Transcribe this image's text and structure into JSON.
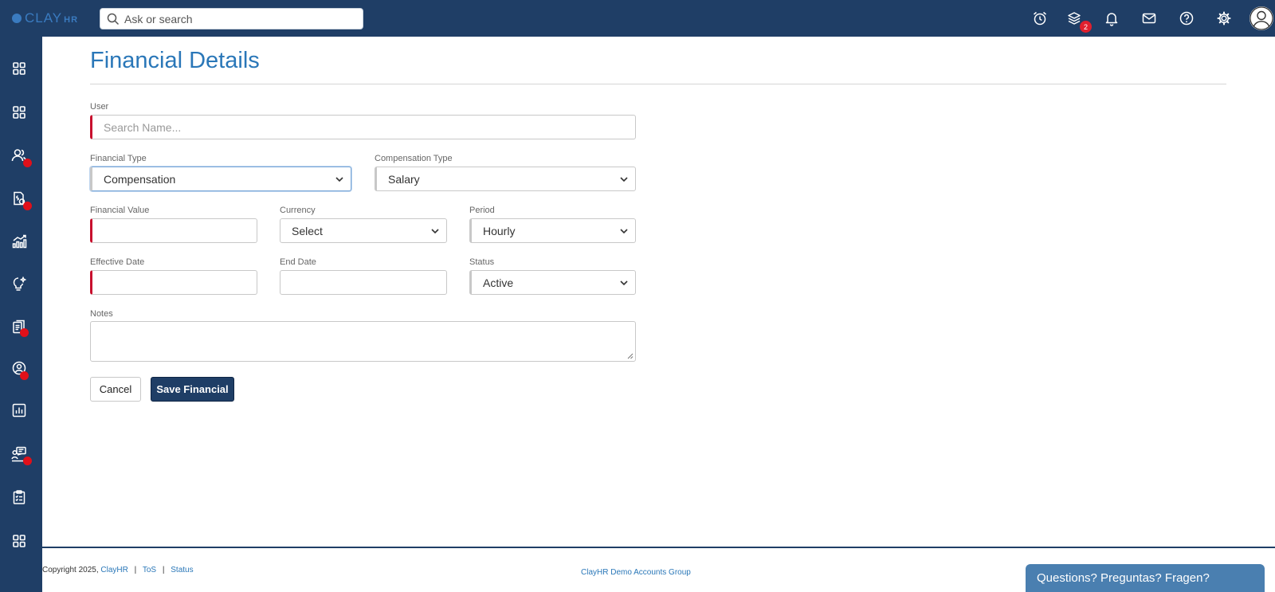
{
  "app": {
    "logo_text": "CLAY",
    "logo_suffix": "HR",
    "search_placeholder": "Ask or search",
    "notification_badge": "2"
  },
  "topbar_icons": [
    "alarm-clock-icon",
    "layers-icon",
    "bell-icon",
    "mail-icon",
    "help-icon",
    "gear-icon",
    "user-avatar-icon"
  ],
  "sidebar_icons": [
    "grid-icon",
    "grid-icon",
    "people-icon",
    "dollar-report-icon",
    "chart-icon",
    "lightbulb-icon",
    "documents-icon",
    "person-circle-icon",
    "bar-chart-icon",
    "training-icon",
    "clipboard-icon",
    "grid-icon"
  ],
  "page": {
    "title": "Financial Details"
  },
  "form": {
    "user_label": "User",
    "user_placeholder": "Search Name...",
    "financial_type_label": "Financial Type",
    "financial_type_value": "Compensation",
    "compensation_type_label": "Compensation Type",
    "compensation_type_value": "Salary",
    "financial_value_label": "Financial Value",
    "financial_value_value": "",
    "currency_label": "Currency",
    "currency_value": "Select",
    "period_label": "Period",
    "period_value": "Hourly",
    "effective_date_label": "Effective Date",
    "effective_date_value": "",
    "end_date_label": "End Date",
    "end_date_value": "",
    "status_label": "Status",
    "status_value": "Active",
    "notes_label": "Notes",
    "notes_value": "",
    "cancel_label": "Cancel",
    "save_label": "Save Financial"
  },
  "footer": {
    "copyright": "Copyright 2025,",
    "company_link": "ClayHR",
    "tos_link": "ToS",
    "status_link": "Status",
    "group_name": "ClayHR Demo Accounts Group",
    "chat_label": "Questions? Preguntas? Fragen?"
  },
  "colors": {
    "nav_bg": "#1f3e66",
    "title_blue": "#2a77b8",
    "required_red": "#c8102e",
    "badge_red": "#e0202e"
  }
}
